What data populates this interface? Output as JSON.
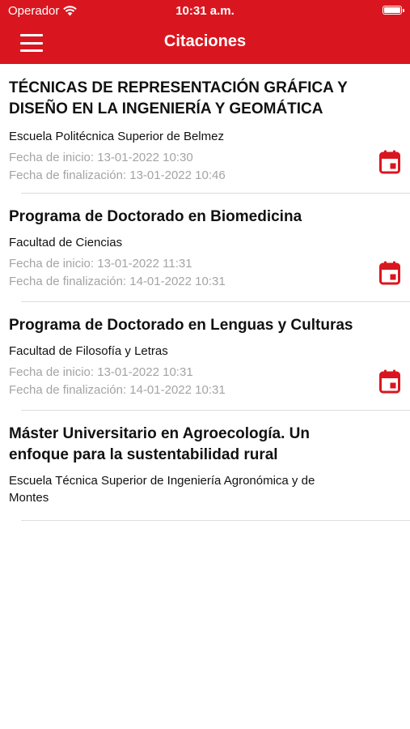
{
  "status_bar": {
    "carrier": "Operador",
    "time": "10:31 a.m."
  },
  "header": {
    "title": "Citaciones",
    "menu_icon": "hamburger-menu-icon",
    "background_color": "#d9161f"
  },
  "citations": [
    {
      "title": "TÉCNICAS DE REPRESENTACIÓN GRÁFICA Y DISEÑO EN LA INGENIERÍA Y GEOMÁTICA",
      "faculty": "Escuela Politécnica Superior de Belmez",
      "start": "Fecha de inicio: 13-01-2022 10:30",
      "end": "Fecha de finalización: 13-01-2022 10:46",
      "icon": "calendar-icon"
    },
    {
      "title": "Programa de Doctorado en Biomedicina",
      "faculty": "Facultad de Ciencias",
      "start": "Fecha de inicio: 13-01-2022 11:31",
      "end": "Fecha de finalización: 14-01-2022 10:31",
      "icon": "calendar-icon"
    },
    {
      "title": "Programa de Doctorado en Lenguas y Culturas",
      "faculty": "Facultad de Filosofía y Letras",
      "start": "Fecha de inicio: 13-01-2022 10:31",
      "end": "Fecha de finalización: 14-01-2022 10:31",
      "icon": "calendar-icon"
    },
    {
      "title": "Máster Universitario en Agroecología. Un enfoque para la sustentabilidad rural",
      "faculty": "Escuela Técnica Superior de Ingeniería Agronómica y de Montes"
    }
  ]
}
